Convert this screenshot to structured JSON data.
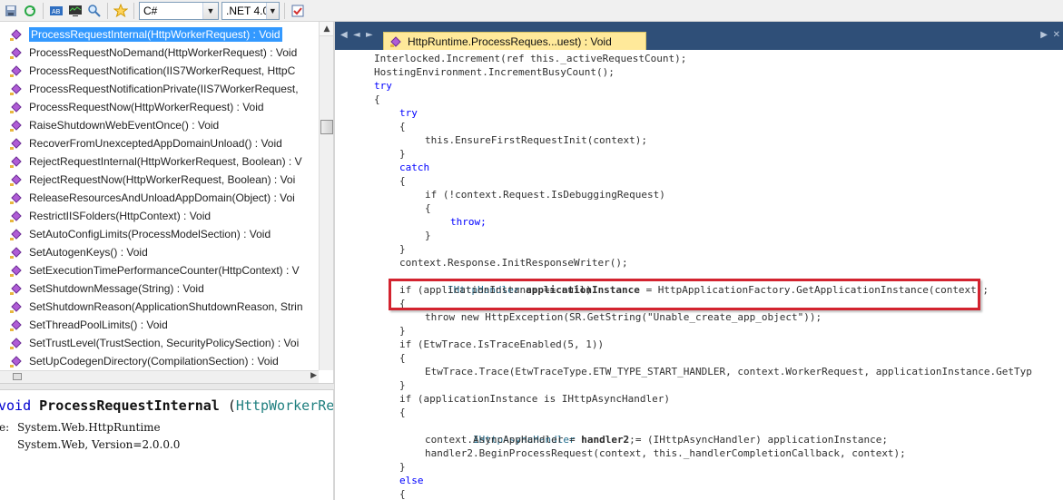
{
  "toolbar": {
    "language": "C#",
    "framework": ".NET 4.0"
  },
  "tree": {
    "items": [
      "ProcessRequestInternal(HttpWorkerRequest) : Void",
      "ProcessRequestNoDemand(HttpWorkerRequest) : Void",
      "ProcessRequestNotification(IIS7WorkerRequest, HttpC",
      "ProcessRequestNotificationPrivate(IIS7WorkerRequest,",
      "ProcessRequestNow(HttpWorkerRequest) : Void",
      "RaiseShutdownWebEventOnce() : Void",
      "RecoverFromUnexceptedAppDomainUnload() : Void",
      "RejectRequestInternal(HttpWorkerRequest, Boolean) : V",
      "RejectRequestNow(HttpWorkerRequest, Boolean) : Voi",
      "ReleaseResourcesAndUnloadAppDomain(Object) : Voi",
      "RestrictIISFolders(HttpContext) : Void",
      "SetAutoConfigLimits(ProcessModelSection) : Void",
      "SetAutogenKeys() : Void",
      "SetExecutionTimePerformanceCounter(HttpContext) : V",
      "SetShutdownMessage(String) : Void",
      "SetShutdownReason(ApplicationShutdownReason, Strin",
      "SetThreadPoolLimits() : Void",
      "SetTrustLevel(TrustSection, SecurityPolicySection) : Voi",
      "SetUpCodegenDirectory(CompilationSection) : Void"
    ]
  },
  "details": {
    "keyword": "void",
    "method": "ProcessRequestInternal",
    "param_type": "HttpWorkerRe",
    "type_label": "e:",
    "type_value": "System.Web.HttpRuntime",
    "assembly_value": "System.Web, Version=2.0.0.0"
  },
  "editor": {
    "tab_title": "HttpRuntime.ProcessReques...uest) : Void"
  },
  "code": {
    "l1": "Interlocked.Increment(ref this._activeRequestCount);",
    "l2": "HostingEnvironment.IncrementBusyCount();",
    "l3": "try",
    "l4": "{",
    "l5": "try",
    "l6": "{",
    "l7": "this.EnsureFirstRequestInit(context);",
    "l8": "}",
    "l9": "catch",
    "l10": "{",
    "l11": "if (!context.Request.IsDebuggingRequest)",
    "l12": "{",
    "l13": "throw;",
    "l14": "}",
    "l15": "}",
    "l16": "context.Response.InitResponseWriter();",
    "l17_type": "IHttpHandler",
    "l17_var": "applicationInstance",
    "l17_rest": "= HttpApplicationFactory.GetApplicationInstance(context);",
    "l18": "if (applicationInstance == null)",
    "l19": "{",
    "l20": "throw new HttpException(SR.GetString(\"Unable_create_app_object\"));",
    "l21": "}",
    "l22": "if (EtwTrace.IsTraceEnabled(5, 1))",
    "l23": "{",
    "l24": "EtwTrace.Trace(EtwTraceType.ETW_TYPE_START_HANDLER, context.WorkerRequest, applicationInstance.GetTyp",
    "l25": "}",
    "l26": "if (applicationInstance is IHttpAsyncHandler)",
    "l27": "{",
    "l28_type": "IHttpAsyncHandler",
    "l28_var": "handler2",
    "l28_rest": "= (IHttpAsyncHandler) applicationInstance;",
    "l29": "context.AsyncAppHandler = handler2;",
    "l30": "handler2.BeginProcessRequest(context, this._handlerCompletionCallback, context);",
    "l31": "}",
    "l32": "else",
    "l33": "{"
  },
  "colors": {
    "selection": "#3399ff",
    "tab_background": "#ffe99a",
    "editor_tab_strip": "#2f4f78",
    "highlight_box": "#d3232f",
    "keyword": "#0000ff"
  }
}
